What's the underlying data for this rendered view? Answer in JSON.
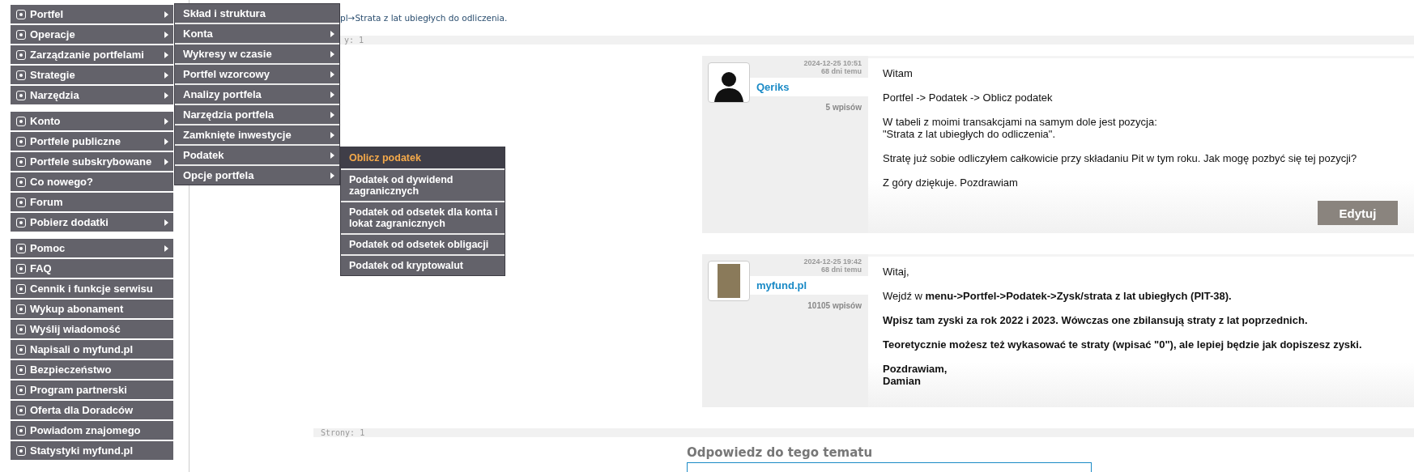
{
  "main_menu": {
    "groups": [
      {
        "items": [
          {
            "label": "Portfel",
            "submenu": true
          },
          {
            "label": "Operacje",
            "submenu": true
          },
          {
            "label": "Zarządzanie portfelami",
            "submenu": true
          },
          {
            "label": "Strategie",
            "submenu": true
          },
          {
            "label": "Narzędzia",
            "submenu": true
          }
        ]
      },
      {
        "items": [
          {
            "label": "Konto",
            "submenu": true
          },
          {
            "label": "Portfele publiczne",
            "submenu": true
          },
          {
            "label": "Portfele subskrybowane",
            "submenu": true
          },
          {
            "label": "Co nowego?",
            "submenu": false
          },
          {
            "label": "Forum",
            "submenu": false
          },
          {
            "label": "Pobierz dodatki",
            "submenu": true
          }
        ]
      },
      {
        "items": [
          {
            "label": "Pomoc",
            "submenu": true
          },
          {
            "label": "FAQ",
            "submenu": false
          },
          {
            "label": "Cennik i funkcje serwisu",
            "submenu": false
          },
          {
            "label": "Wykup abonament",
            "submenu": false
          },
          {
            "label": "Wyślij wiadomość",
            "submenu": false
          },
          {
            "label": "Napisali o myfund.pl",
            "submenu": false
          },
          {
            "label": "Bezpieczeństwo",
            "submenu": false
          },
          {
            "label": "Program partnerski",
            "submenu": false
          },
          {
            "label": "Oferta dla Doradców",
            "submenu": false
          },
          {
            "label": "Powiadom znajomego",
            "submenu": false
          },
          {
            "label": "Statystyki myfund.pl",
            "submenu": false
          }
        ]
      }
    ]
  },
  "submenu": {
    "items": [
      {
        "label": "Skład i struktura",
        "submenu": false
      },
      {
        "label": "Konta",
        "submenu": true
      },
      {
        "label": "Wykresy w czasie",
        "submenu": true
      },
      {
        "label": "Portfel wzorcowy",
        "submenu": true
      },
      {
        "label": "Analizy portfela",
        "submenu": true
      },
      {
        "label": "Narzędzia portfela",
        "submenu": true
      },
      {
        "label": "Zamknięte inwestycje",
        "submenu": true
      },
      {
        "label": "Podatek",
        "submenu": true
      },
      {
        "label": "Opcje portfela",
        "submenu": true
      }
    ]
  },
  "tax_submenu": {
    "items": [
      {
        "label": "Oblicz podatek",
        "selected": true
      },
      {
        "label": "Podatek od dywidend zagranicznych",
        "selected": false
      },
      {
        "label": "Podatek od odsetek dla konta i lokat zagranicznych",
        "selected": false
      },
      {
        "label": "Podatek od odsetek obligacji",
        "selected": false
      },
      {
        "label": "Podatek od kryptowalut",
        "selected": false
      }
    ]
  },
  "breadcrumb": "pl→Strata z lat ubiegłych do odliczenia.",
  "pager_top": "y: 1",
  "posts": [
    {
      "date": "2024-12-25 10:51",
      "age": "68 dni temu",
      "author": "Qeriks",
      "avatar": {
        "kind": "silhouette"
      },
      "post_count": "5 wpisów",
      "paragraphs": [
        {
          "text": "Witam",
          "bold": false
        },
        {
          "text": "Portfel -> Podatek -> Oblicz podatek",
          "bold": false
        },
        {
          "text": "W tabeli z moimi transakcjami na samym dole jest pozycja:\n\"Strata z lat ubiegłych do odliczenia\".",
          "bold": false
        },
        {
          "text": "Stratę już sobie odliczyłem całkowicie przy składaniu Pit w tym roku. Jak mogę pozbyć się tej pozycji?",
          "bold": false
        },
        {
          "text": "Z góry dziękuje. Pozdrawiam",
          "bold": false
        }
      ],
      "edit_button": "Edytuj"
    },
    {
      "date": "2024-12-25 19:42",
      "age": "68 dni temu",
      "author": "myfund.pl",
      "avatar": {
        "kind": "photo"
      },
      "post_count": "10105 wpisów",
      "paragraphs": [
        {
          "text": "Witaj,",
          "bold": false
        },
        {
          "text": "Wejdź w **menu->Portfel->Podatek->Zysk/strata z lat ubiegłych (PIT-38).**",
          "bold": false
        },
        {
          "text": "Wpisz tam zyski za rok 2022 i 2023. Wówczas one zbilansują straty z lat poprzednich.",
          "bold": true
        },
        {
          "text": "Teoretycznie możesz też wykasować te straty (wpisać \"0\"), ale lepiej będzie jak dopiszesz zyski.",
          "bold": true
        },
        {
          "text": "Pozdrawiam,\nDamian",
          "bold": true
        }
      ]
    }
  ],
  "pager_bottom": "Strony: 1",
  "reply": {
    "heading": "Odpowiedz do tego tematu"
  }
}
